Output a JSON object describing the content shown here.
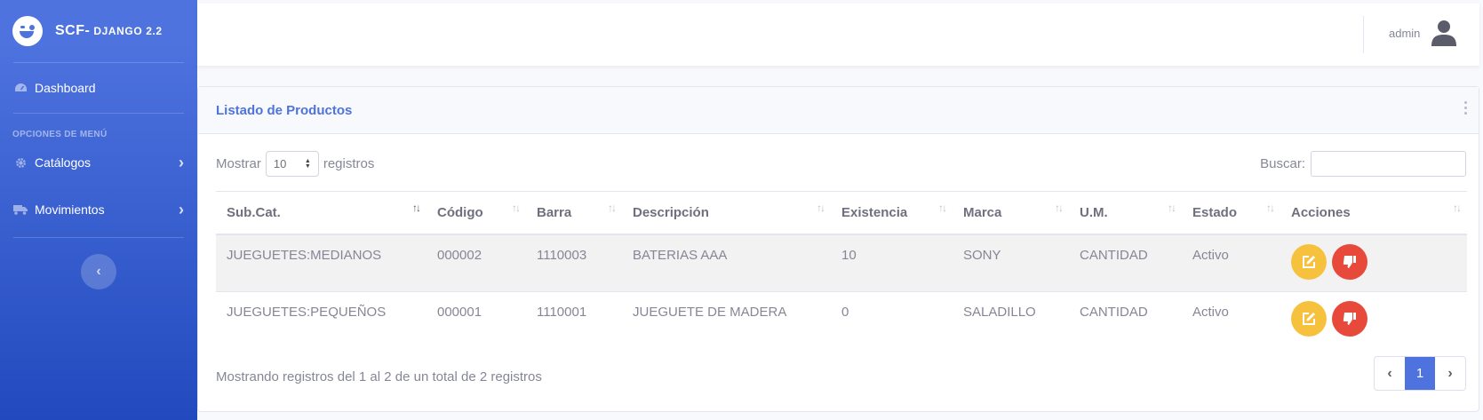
{
  "sidebar": {
    "brand_main": "SCF-",
    "brand_sub": "DJANGO 2.2",
    "dashboard_label": "Dashboard",
    "section_heading": "OPCIONES DE MENÚ",
    "items": [
      {
        "label": "Catálogos",
        "icon": "cog-icon"
      },
      {
        "label": "Movimientos",
        "icon": "truck-icon"
      }
    ]
  },
  "topbar": {
    "user_name": "admin"
  },
  "card": {
    "title": "Listado de Productos"
  },
  "controls": {
    "show_label": "Mostrar",
    "page_length": "10",
    "records_label": "registros",
    "search_label": "Buscar:",
    "search_value": ""
  },
  "table": {
    "headers": [
      "Sub.Cat.",
      "Código",
      "Barra",
      "Descripción",
      "Existencia",
      "Marca",
      "U.M.",
      "Estado",
      "Acciones"
    ],
    "rows": [
      [
        "JUEGUETES:MEDIANOS",
        "000002",
        "1110003",
        "BATERIAS AAA",
        "10",
        "SONY",
        "CANTIDAD",
        "Activo"
      ],
      [
        "JUEGUETES:PEQUEÑOS",
        "000001",
        "1110001",
        "JUEGUETE DE MADERA",
        "0",
        "SALADILLO",
        "CANTIDAD",
        "Activo"
      ]
    ]
  },
  "footer": {
    "info": "Mostrando registros del 1 al 2 de un total de 2 registros",
    "current_page": "1"
  },
  "colors": {
    "primary": "#4e73df",
    "warning": "#f6c23e",
    "danger": "#e74a3b"
  }
}
